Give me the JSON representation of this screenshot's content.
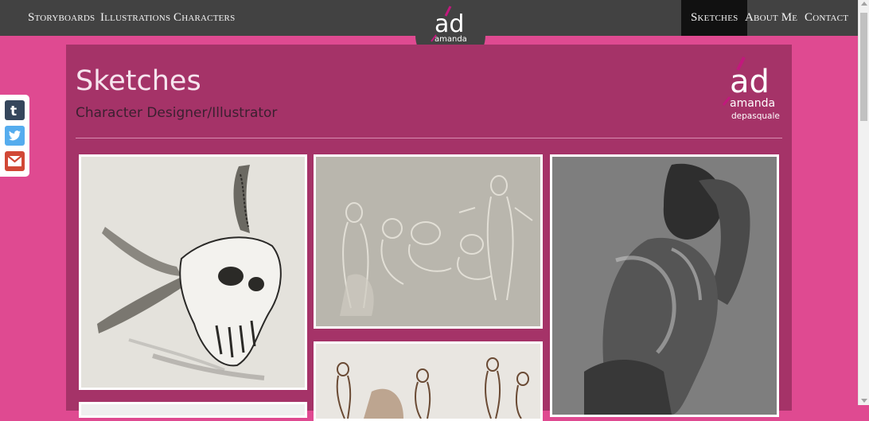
{
  "nav": {
    "left": [
      "Storyboards",
      "Illustrations",
      "Characters"
    ],
    "right": [
      "Sketches",
      "About Me",
      "Contact"
    ],
    "active": "Sketches"
  },
  "logo": {
    "initials": "ad",
    "first": "amanda",
    "last": "depasquale"
  },
  "page": {
    "title": "Sketches",
    "subtitle": "Character Designer/Illustrator"
  },
  "share": [
    "tumblr-icon",
    "twitter-icon",
    "gmail-icon"
  ],
  "colors": {
    "background": "#df4a91",
    "panel": "#a53368",
    "nav": "#424242",
    "accent": "#c2187d"
  },
  "gallery": [
    "animal skull sketch",
    "figure drawing studies",
    "muscular figure digital painting",
    "figure gesture drawings"
  ]
}
